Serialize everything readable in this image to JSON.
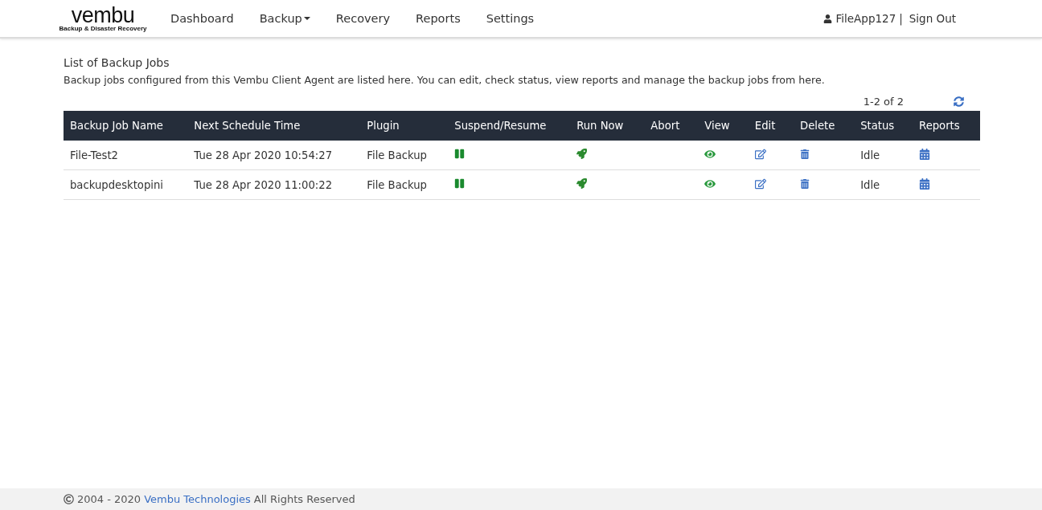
{
  "header": {
    "logo": {
      "wordmark": "vembu",
      "tagline": "Backup & Disaster Recovery"
    },
    "nav": [
      {
        "label": "Dashboard",
        "dropdown": false
      },
      {
        "label": "Backup",
        "dropdown": true
      },
      {
        "label": "Recovery",
        "dropdown": false
      },
      {
        "label": "Reports",
        "dropdown": false
      },
      {
        "label": "Settings",
        "dropdown": false
      }
    ],
    "user": {
      "name": "FileApp127",
      "separator": "|",
      "sign_out": "Sign Out"
    }
  },
  "page": {
    "title": "List of Backup Jobs",
    "description": "Backup jobs configured from this Vembu Client Agent are listed here. You can edit, check status, view reports and manage the backup jobs from here.",
    "pagination": "1-2 of 2"
  },
  "table": {
    "columns": [
      "Backup Job Name",
      "Next Schedule Time",
      "Plugin",
      "Suspend/Resume",
      "Run Now",
      "Abort",
      "View",
      "Edit",
      "Delete",
      "Status",
      "Reports"
    ],
    "rows": [
      {
        "name": "File-Test2",
        "next_schedule": "Tue 28 Apr 2020 10:54:27",
        "plugin": "File Backup",
        "status": "Idle"
      },
      {
        "name": "backupdesktopini",
        "next_schedule": "Tue 28 Apr 2020 11:00:22",
        "plugin": "File Backup",
        "status": "Idle"
      }
    ]
  },
  "footer": {
    "prefix": "2004 - 2020",
    "link": "Vembu Technologies",
    "suffix": "All Rights Reserved"
  }
}
